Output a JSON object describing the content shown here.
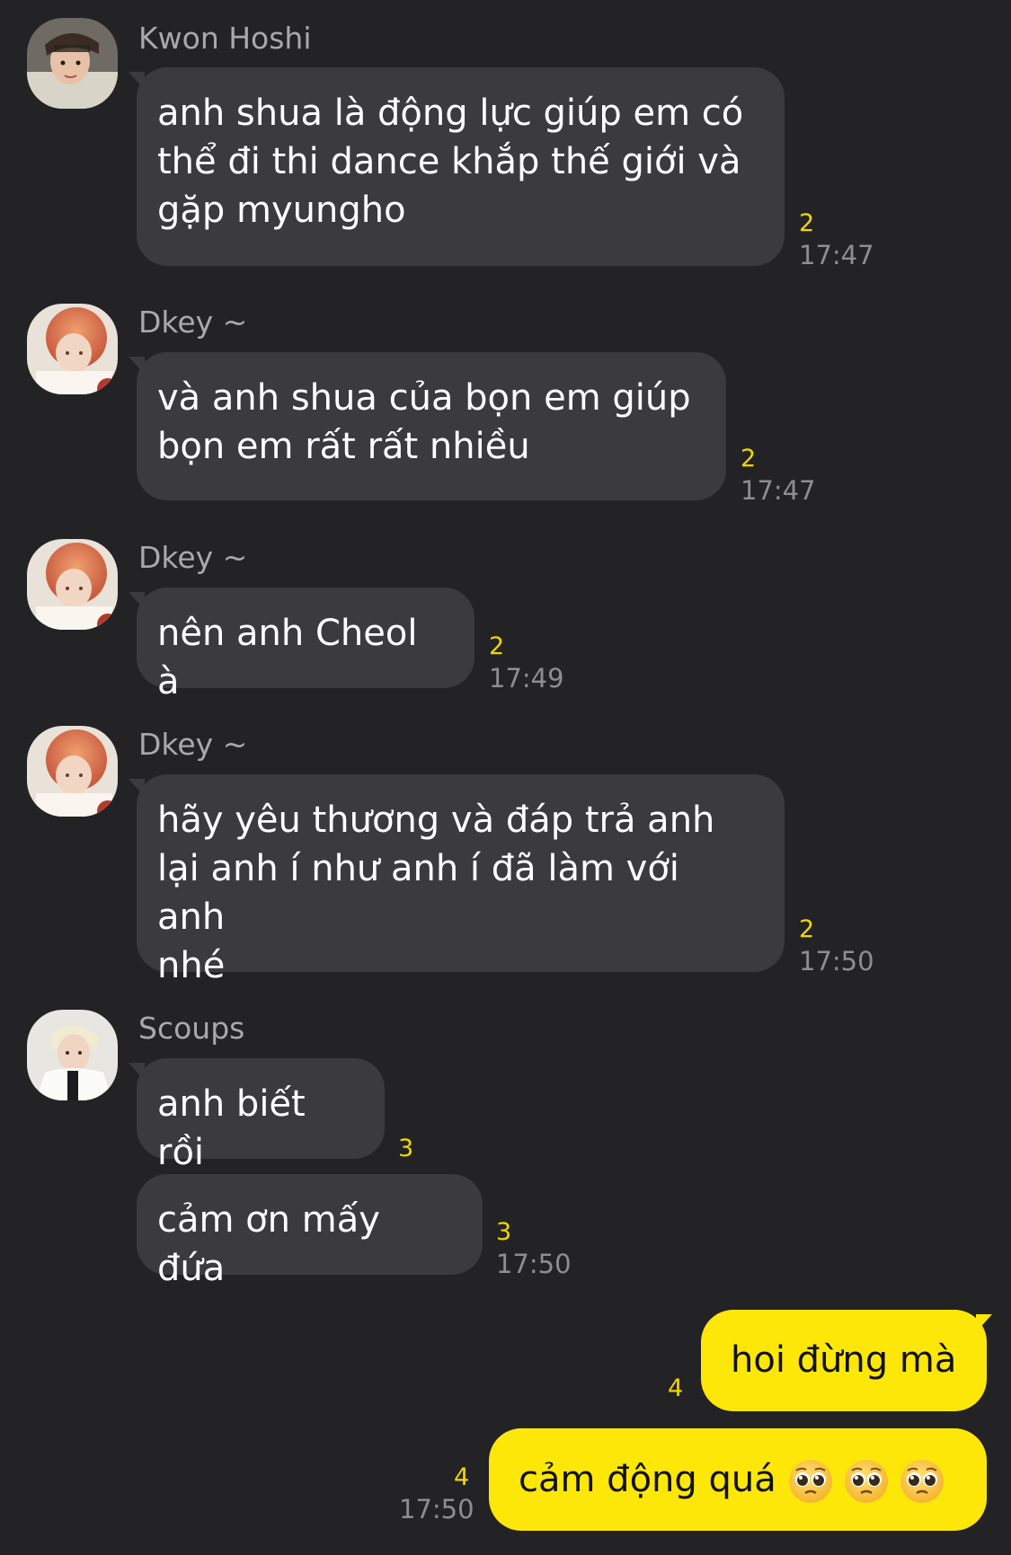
{
  "colors": {
    "background": "#232325",
    "incoming_bubble": "#3b3b3e",
    "outgoing_bubble": "#fce709",
    "unread_count": "#f2d600",
    "timestamp": "#8e8e92",
    "sender_name": "#a9a9ad"
  },
  "messages": [
    {
      "sender": "Kwon Hoshi",
      "lines": [
        "anh shua là động lực giúp em có",
        "thể đi thi dance khắp thế giới và",
        "gặp myungho"
      ],
      "unread": "2",
      "time": "17:47"
    },
    {
      "sender": "Dkey ~",
      "lines": [
        "và anh shua của bọn em giúp",
        "bọn em rất rất nhiều"
      ],
      "unread": "2",
      "time": "17:47"
    },
    {
      "sender": "Dkey ~",
      "lines": [
        "nên anh Cheol à"
      ],
      "unread": "2",
      "time": "17:49"
    },
    {
      "sender": "Dkey ~",
      "lines": [
        "hãy yêu thương và đáp trả anh",
        "lại anh í như anh í đã làm với anh",
        "nhé"
      ],
      "unread": "2",
      "time": "17:50"
    },
    {
      "sender": "Scoups",
      "lines": [
        "anh biết rồi"
      ],
      "unread": "3"
    },
    {
      "lines": [
        "cảm ơn mấy đứa"
      ],
      "unread": "3",
      "time": "17:50"
    }
  ],
  "outgoing": [
    {
      "text": "hoi đừng mà",
      "unread": "4"
    },
    {
      "text": "cảm động quá",
      "emoji": [
        "pleading-face-emoji",
        "pleading-face-emoji",
        "pleading-face-emoji"
      ],
      "unread": "4",
      "time": "17:50"
    }
  ]
}
